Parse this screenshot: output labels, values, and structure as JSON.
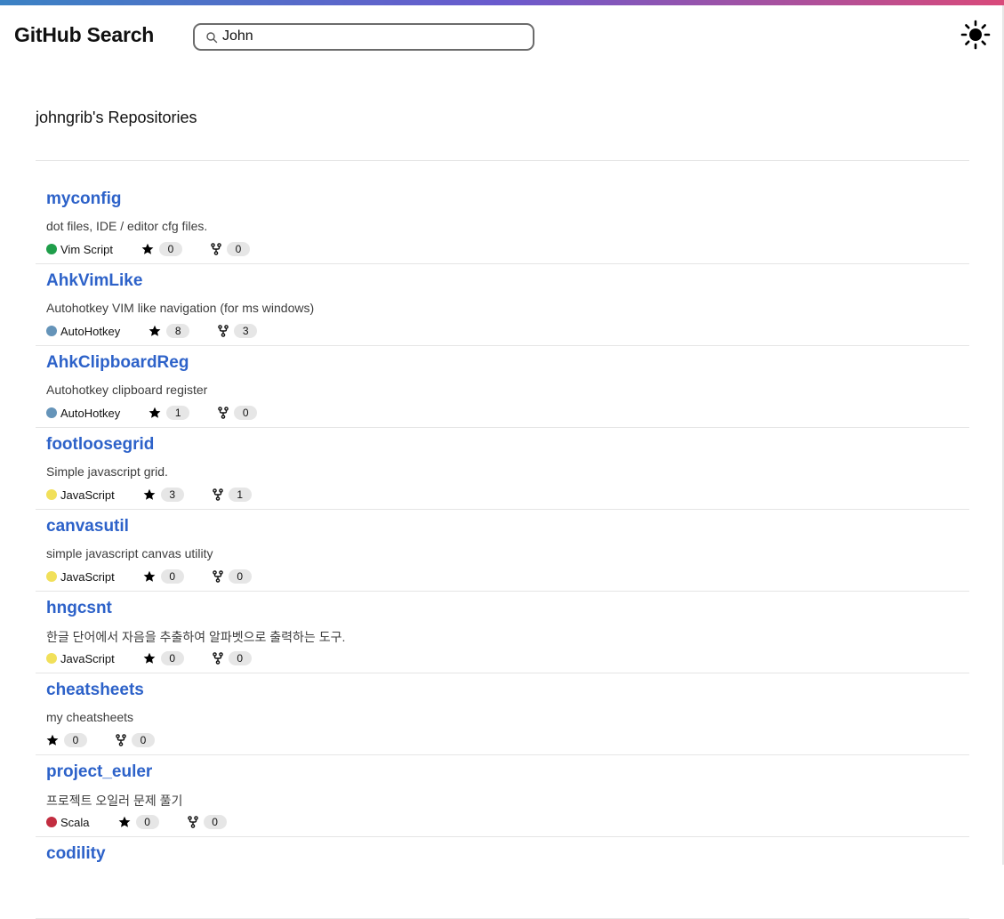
{
  "app": {
    "title": "GitHub Search"
  },
  "search": {
    "value": "John",
    "placeholder": ""
  },
  "header": {
    "theme_icon": "sun-icon"
  },
  "section": {
    "title": "johngrib's Repositories"
  },
  "colors": {
    "link": "#2d62c9",
    "accent_gradient": [
      "#3b82c4",
      "#6a5acd",
      "#d94a7a"
    ]
  },
  "repos": [
    {
      "name": "myconfig",
      "description": "dot files, IDE / editor cfg files.",
      "language": "Vim Script",
      "lang_color": "#1f9e4a",
      "stars": "0",
      "forks": "0"
    },
    {
      "name": "AhkVimLike",
      "description": "Autohotkey VIM like navigation (for ms windows)",
      "language": "AutoHotkey",
      "lang_color": "#6594b9",
      "stars": "8",
      "forks": "3"
    },
    {
      "name": "AhkClipboardReg",
      "description": "Autohotkey clipboard register",
      "language": "AutoHotkey",
      "lang_color": "#6594b9",
      "stars": "1",
      "forks": "0"
    },
    {
      "name": "footloosegrid",
      "description": "Simple javascript grid.",
      "language": "JavaScript",
      "lang_color": "#f1e05a",
      "stars": "3",
      "forks": "1"
    },
    {
      "name": "canvasutil",
      "description": "simple javascript canvas utility",
      "language": "JavaScript",
      "lang_color": "#f1e05a",
      "stars": "0",
      "forks": "0"
    },
    {
      "name": "hngcsnt",
      "description": "한글 단어에서 자음을 추출하여 알파벳으로 출력하는 도구.",
      "language": "JavaScript",
      "lang_color": "#f1e05a",
      "stars": "0",
      "forks": "0"
    },
    {
      "name": "cheatsheets",
      "description": "my cheatsheets",
      "language": "",
      "lang_color": "",
      "stars": "0",
      "forks": "0"
    },
    {
      "name": "project_euler",
      "description": "프로젝트 오일러 문제 풀기",
      "language": "Scala",
      "lang_color": "#c22d40",
      "stars": "0",
      "forks": "0"
    },
    {
      "name": "codility",
      "description": "",
      "language": "",
      "lang_color": "",
      "stars": "",
      "forks": ""
    }
  ]
}
